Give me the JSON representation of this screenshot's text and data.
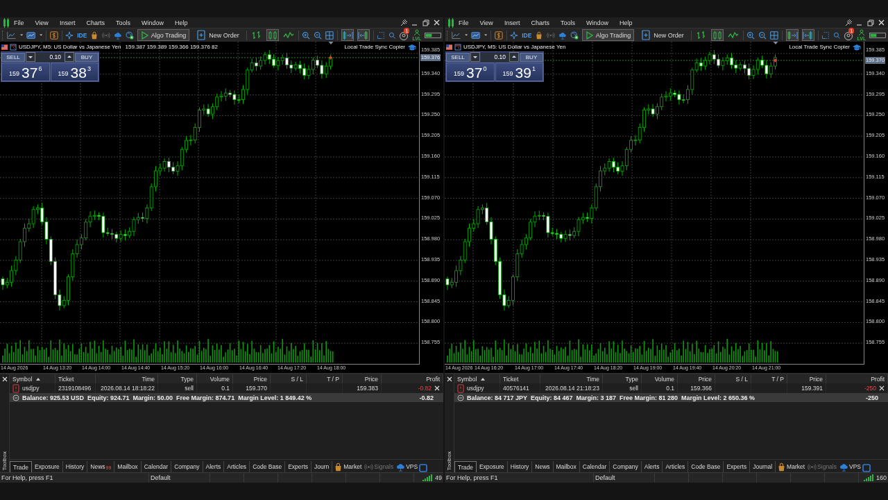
{
  "terminals": [
    {
      "menu": [
        "File",
        "View",
        "Insert",
        "Charts",
        "Tools",
        "Window",
        "Help"
      ],
      "toolbar": {
        "ide": "IDE",
        "algo_trading": "Algo Trading",
        "new_order": "New Order",
        "chart_types": [
          {
            "selected": false
          },
          {
            "selected": true
          },
          {
            "selected": false
          }
        ],
        "chart_options": [
          {
            "selected": true
          },
          {
            "selected": true
          }
        ],
        "notifications": "1",
        "level_badge": "LVL"
      },
      "chart": {
        "symbol": "USDJPY, M5:  US Dollar vs Japanese Yen",
        "quote": "159.387 159.389 159.366 159.376 82",
        "copier": "Local Trade Sync Copier",
        "trade_panel": {
          "sell": "SELL",
          "buy": "BUY",
          "volume": "0.10",
          "bid": {
            "big": "159",
            "main": "37",
            "small": "6"
          },
          "ask": {
            "big": "159",
            "main": "38",
            "small": "3"
          }
        },
        "price_ticks": [
          "159.385",
          "159.340",
          "159.295",
          "159.250",
          "159.205",
          "159.160",
          "159.115",
          "159.070",
          "159.025",
          "158.980",
          "158.935",
          "158.890",
          "158.845",
          "158.800",
          "158.755"
        ],
        "current_price": "159.376",
        "time_ticks": [
          "14 Aug 2026",
          "14 Aug 13:20",
          "14 Aug 14:00",
          "14 Aug 14:40",
          "14 Aug 15:20",
          "14 Aug 16:00",
          "14 Aug 16:40",
          "14 Aug 17:20",
          "14 Aug 18:00"
        ]
      },
      "toolbox": {
        "title": "Toolbox",
        "columns": [
          "Symbol",
          "Ticket",
          "Time",
          "Type",
          "Volume",
          "Price",
          "S / L",
          "T / P",
          "Price",
          "Profit"
        ],
        "rows": [
          {
            "symbol": "usdjpy",
            "ticket": "2319108496",
            "time": "2026.08.14 18:18:22",
            "type": "sell",
            "volume": "0.1",
            "price": "159.370",
            "sl": "",
            "tp": "",
            "current": "159.383",
            "profit": "-0.82"
          }
        ],
        "balance": "Balance: 925.53 USD  Equity: 924.71  Margin: 50.00  Free Margin: 874.71  Margin Level: 1 849.42 %",
        "total_profit": "-0.82",
        "tabs": [
          {
            "label": "Trade",
            "selected": true
          },
          {
            "label": "Exposure",
            "selected": false
          },
          {
            "label": "History",
            "selected": false
          },
          {
            "label": "News",
            "selected": false,
            "badge": "99"
          },
          {
            "label": "Mailbox",
            "selected": false
          },
          {
            "label": "Calendar",
            "selected": false
          },
          {
            "label": "Company",
            "selected": false
          },
          {
            "label": "Alerts",
            "selected": false
          },
          {
            "label": "Articles",
            "selected": false
          },
          {
            "label": "Code Base",
            "selected": false
          },
          {
            "label": "Experts",
            "selected": false
          },
          {
            "label": "Journ",
            "selected": false
          }
        ],
        "side_tabs": [
          {
            "label": "Market",
            "disabled": false
          },
          {
            "label": "Signals",
            "disabled": true
          },
          {
            "label": "VPS",
            "disabled": false
          }
        ]
      },
      "status_bar": {
        "help": "For Help, press F1",
        "profile": "Default",
        "ping": "49"
      }
    },
    {
      "menu": [
        "File",
        "View",
        "Insert",
        "Charts",
        "Tools",
        "Window",
        "Help"
      ],
      "toolbar": {
        "ide": "IDE",
        "algo_trading": "Algo Trading",
        "new_order": "New Order",
        "chart_types": [
          {
            "selected": false
          },
          {
            "selected": true
          },
          {
            "selected": false
          }
        ],
        "chart_options": [
          {
            "selected": true
          },
          {
            "selected": true
          }
        ],
        "notifications": "1",
        "level_badge": "LVL"
      },
      "chart": {
        "symbol": "USDJPY, M5:  US Dollar vs Japanese Yen",
        "copier": "Local Trade Sync Copier",
        "trade_panel": {
          "sell": "SELL",
          "buy": "BUY",
          "volume": "0.10",
          "bid": {
            "big": "159",
            "main": "37",
            "small": "0"
          },
          "ask": {
            "big": "159",
            "main": "39",
            "small": "1"
          }
        },
        "price_ticks": [
          "159.385",
          "159.340",
          "159.295",
          "159.250",
          "159.205",
          "159.160",
          "159.115",
          "159.070",
          "159.025",
          "158.980",
          "158.935",
          "158.890",
          "158.845",
          "158.800",
          "158.755"
        ],
        "current_price": "159.370",
        "time_ticks": [
          "14 Aug 2026",
          "14 Aug 16:20",
          "14 Aug 17:00",
          "14 Aug 17:40",
          "14 Aug 18:20",
          "14 Aug 19:00",
          "14 Aug 19:40",
          "14 Aug 20:20",
          "14 Aug 21:00"
        ]
      },
      "toolbox": {
        "title": "Toolbox",
        "columns": [
          "Symbol",
          "Ticket",
          "Time",
          "Type",
          "Volume",
          "Price",
          "S / L",
          "T / P",
          "Price",
          "Profit"
        ],
        "rows": [
          {
            "symbol": "usdjpy",
            "ticket": "40576141",
            "time": "2026.08.14 21:18:23",
            "type": "sell",
            "volume": "0.1",
            "price": "159.366",
            "sl": "",
            "tp": "",
            "current": "159.391",
            "profit": "-250"
          }
        ],
        "balance": "Balance: 84 717 JPY  Equity: 84 467  Margin: 3 187  Free Margin: 81 280  Margin Level: 2 650.36 %",
        "total_profit": "-250",
        "tabs": [
          {
            "label": "Trade",
            "selected": true
          },
          {
            "label": "Exposure",
            "selected": false
          },
          {
            "label": "History",
            "selected": false
          },
          {
            "label": "News",
            "selected": false
          },
          {
            "label": "Mailbox",
            "selected": false
          },
          {
            "label": "Calendar",
            "selected": false
          },
          {
            "label": "Company",
            "selected": false
          },
          {
            "label": "Alerts",
            "selected": false
          },
          {
            "label": "Articles",
            "selected": false
          },
          {
            "label": "Code Base",
            "selected": false
          },
          {
            "label": "Experts",
            "selected": false
          },
          {
            "label": "Journal",
            "selected": false
          }
        ],
        "side_tabs": [
          {
            "label": "Market",
            "disabled": false
          },
          {
            "label": "Signals",
            "disabled": true
          },
          {
            "label": "VPS",
            "disabled": false
          }
        ]
      },
      "status_bar": {
        "help": "For Help, press F1",
        "profile": "Default",
        "ping": "160"
      }
    }
  ]
}
